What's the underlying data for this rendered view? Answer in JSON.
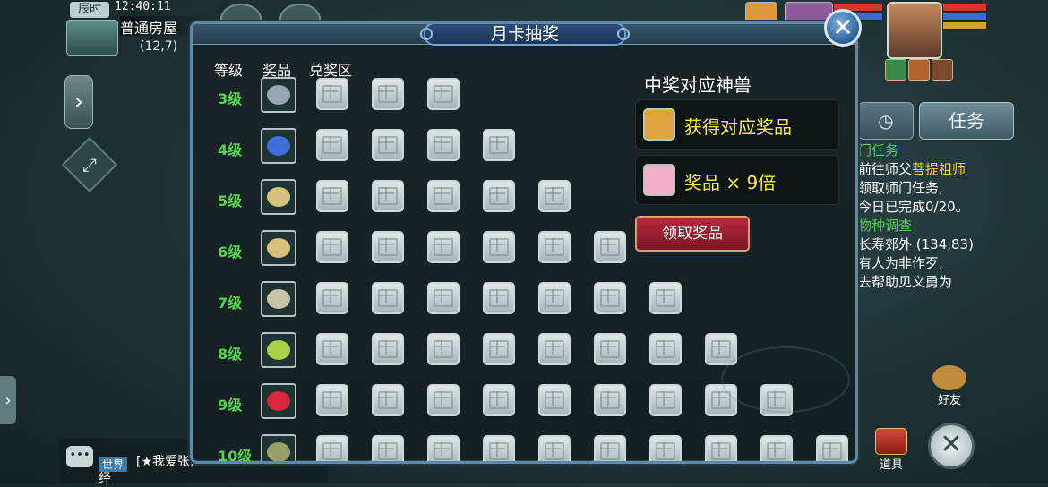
{
  "hud": {
    "time_tag": "辰时",
    "clock": "12:40:11",
    "map_name": "普通房屋",
    "coords": "(12,7)"
  },
  "right_hud": {
    "task_tab": "任务",
    "quest_title_1": "门任务",
    "quest_line_1a": "前往师父",
    "quest_link": "菩提祖师",
    "quest_line_1b": "领取师门任务,",
    "quest_line_1c": "今日已完成0/20。",
    "quest_title_2": "物种调查",
    "quest_line_2a": "长寿郊外 (134,83)",
    "quest_line_2b": "有人为非作歹,",
    "quest_line_2c": "去帮助见义勇为",
    "friend_label": "好友",
    "items_label": "道具"
  },
  "chat": {
    "channel": "世界",
    "text": "[★我爱张...",
    "text_line2": "经"
  },
  "dialog": {
    "title": "月卡抽奖",
    "headers": {
      "level": "等级",
      "prize": "奖品",
      "exchange": "兑奖区"
    },
    "rows": [
      {
        "level": "3级",
        "slots": 3,
        "color": "#9aa7b0"
      },
      {
        "level": "4级",
        "slots": 4,
        "color": "#3e6fd6"
      },
      {
        "level": "5级",
        "slots": 5,
        "color": "#d9c07a"
      },
      {
        "level": "6级",
        "slots": 6,
        "color": "#d9c07a"
      },
      {
        "level": "7级",
        "slots": 7,
        "color": "#c8c4a6"
      },
      {
        "level": "8级",
        "slots": 8,
        "color": "#a7d24a"
      },
      {
        "level": "9级",
        "slots": 9,
        "color": "#d8283a"
      },
      {
        "level": "10级",
        "slots": 10,
        "color": "#9aa06a"
      }
    ],
    "beast_title": "中奖对应神兽",
    "beast_rows": [
      {
        "text": "获得对应奖品",
        "color": "#e0a33e"
      },
      {
        "text": "奖品 × 9倍",
        "color": "#f3b0c8"
      }
    ],
    "claim_button": "领取奖品"
  }
}
